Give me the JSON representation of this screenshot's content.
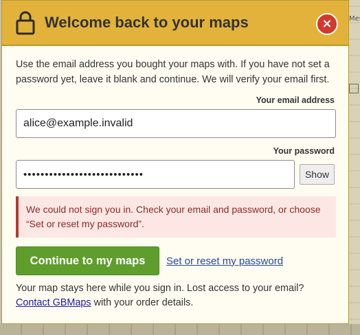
{
  "dialog": {
    "title": "Welcome back to your maps",
    "close_label": "×",
    "intro": "Use the email address you bought your maps with. If you have not set a password yet, leave it blank and continue. We will verify your email first."
  },
  "email": {
    "label": "Your email address",
    "value": "alice@example.invalid"
  },
  "password": {
    "label": "Your password",
    "value": "••••••••••••••••••••••••••••",
    "show_label": "Show"
  },
  "error": {
    "message": "We could not sign you in. Check your email and password, or choose “Set or reset my password”."
  },
  "actions": {
    "primary_label": "Continue to my maps",
    "reset_link": "Set or reset my password"
  },
  "footnote": {
    "text_before": "Your map stays here while you sign in. Lost access to your email? ",
    "link_text": "Contact GBMaps",
    "text_after": " with your order details."
  },
  "background": {
    "map_label": "Mes"
  },
  "colors": {
    "header": "#e2b23a",
    "close": "#d13a2e",
    "primary": "#5f9e2d",
    "error_border": "#b33a2e",
    "error_bg": "#fde7e5"
  },
  "icons": {
    "header": "lock-icon",
    "close": "close-icon",
    "map": "map-icon"
  }
}
